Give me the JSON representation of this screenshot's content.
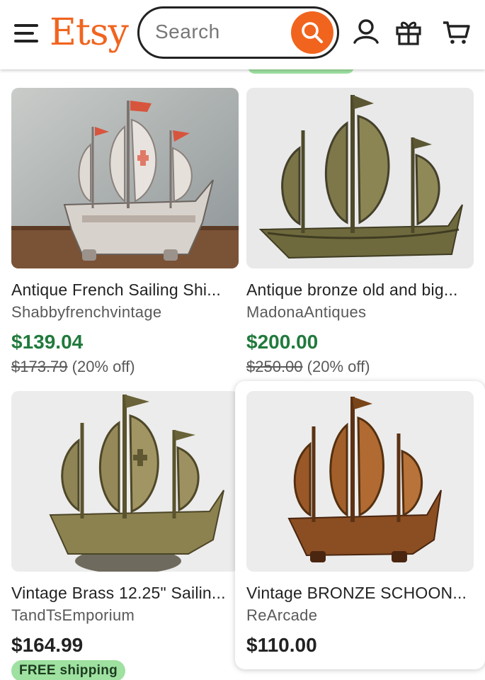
{
  "header": {
    "logo": "Etsy",
    "search_placeholder": "Search",
    "icons": [
      "menu-icon",
      "search-icon",
      "user-icon",
      "gift-icon",
      "cart-icon"
    ],
    "brand_color": "#f1641e"
  },
  "products": [
    {
      "title": "Antique French Sailing Shi...",
      "shop": "Shabbyfrenchvintage",
      "price": "$139.04",
      "original_price": "$173.79",
      "discount": "(20% off)",
      "free_shipping": null
    },
    {
      "title": "Antique bronze old and big...",
      "shop": "MadonaAntiques",
      "price": "$200.00",
      "original_price": "$250.00",
      "discount": "(20% off)",
      "free_shipping": null
    },
    {
      "title": "Vintage Brass 12.25\" Sailin...",
      "shop": "TandTsEmporium",
      "price": "$164.99",
      "original_price": null,
      "discount": null,
      "free_shipping": "FREE shipping"
    },
    {
      "title": "Vintage BRONZE SCHOON...",
      "shop": "ReArcade",
      "price": "$110.00",
      "original_price": null,
      "discount": null,
      "free_shipping": null
    }
  ],
  "colors": {
    "sale_price": "#217a3c",
    "free_shipping_badge": "#9ee1a0"
  }
}
